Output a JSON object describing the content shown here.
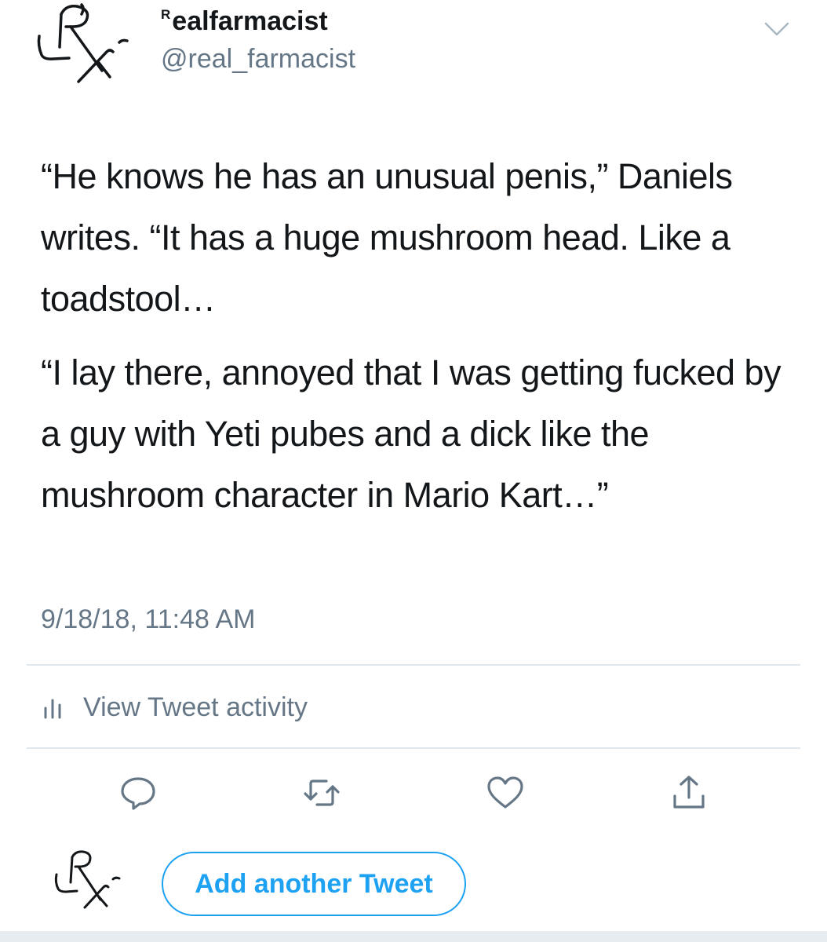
{
  "profile": {
    "display_name_prefix": "R",
    "display_name_rest": "ealfarmacist",
    "handle": "@real_farmacist",
    "avatar_icon": "rx-logo-icon"
  },
  "tweet": {
    "paragraphs": [
      "“He knows he has an unusual penis,” Daniels writes. “It has a huge mushroom head. Like a toadstool…",
      "“I lay there, annoyed that I was getting fucked by a guy with Yeti pubes and a dick like the mushroom character in Mario Kart…”"
    ],
    "timestamp": "9/18/18, 11:48 AM"
  },
  "activity": {
    "label": "View Tweet activity",
    "icon": "bar-chart-icon"
  },
  "actions": [
    {
      "name": "reply",
      "icon": "speech-bubble-icon"
    },
    {
      "name": "retweet",
      "icon": "retweet-icon"
    },
    {
      "name": "like",
      "icon": "heart-icon"
    },
    {
      "name": "share",
      "icon": "share-icon"
    }
  ],
  "composer": {
    "button_label": "Add another Tweet"
  },
  "colors": {
    "accent": "#1da1f2",
    "secondary_text": "#657786",
    "divider": "#e1e8ed",
    "primary_text": "#14171a"
  }
}
